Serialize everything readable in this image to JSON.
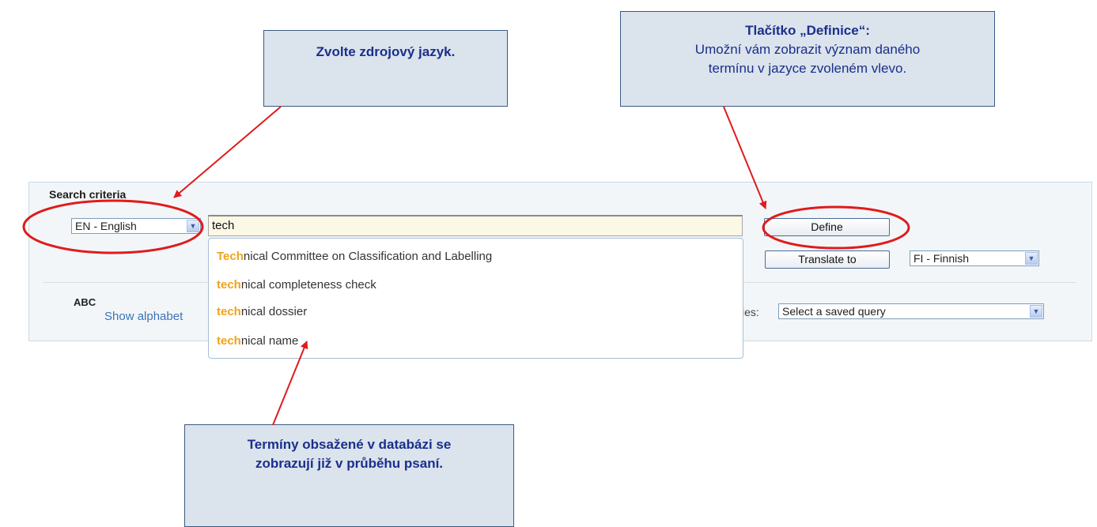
{
  "search_panel": {
    "title": "Search criteria",
    "source_language": "EN - English",
    "search_value": "tech",
    "define_label": "Define",
    "translate_label": "Translate to",
    "target_language": "FI - Finnish",
    "alphabet_icon": "ABC",
    "alphabet_link": "Show alphabet",
    "saved_queries_label": "ies:",
    "saved_query_placeholder": "Select a saved query"
  },
  "suggestions": [
    {
      "match": "Tech",
      "rest": "nical Committee on Classification and Labelling"
    },
    {
      "match": "tech",
      "rest": "nical completeness check"
    },
    {
      "match": "tech",
      "rest": "nical dossier"
    },
    {
      "match": "tech",
      "rest": "nical name"
    }
  ],
  "callouts": {
    "source_language": "Zvolte zdrojový jazyk.",
    "define_title": "Tlačítko „Definice“:",
    "define_text_1": "Umožní vám zobrazit význam daného",
    "define_text_2": "termínu v jazyce zvoleném vlevo.",
    "suggestions_1": "Termíny obsažené v databázi se",
    "suggestions_2": "zobrazují již v průběhu psaní."
  },
  "colors": {
    "annotation_red": "#e01b1b",
    "highlight_orange": "#f0a31a",
    "callout_text": "#1a2f8c",
    "link_blue": "#3b73ba"
  }
}
